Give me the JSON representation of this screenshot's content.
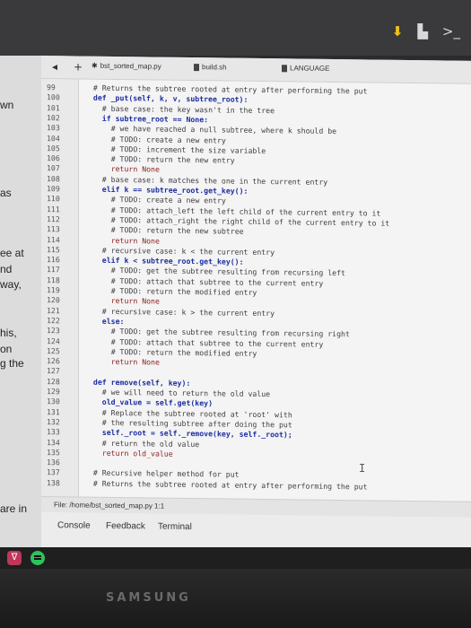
{
  "side_document": {
    "fragments": [
      "wn",
      "as",
      "ee at",
      "nd",
      "way,",
      "his,",
      "on",
      "g the",
      "are in"
    ]
  },
  "editor": {
    "tabs": [
      {
        "label": "bst_sorted_map.py"
      },
      {
        "label": "build.sh"
      },
      {
        "label": "LANGUAGE"
      }
    ],
    "lines": [
      {
        "n": "99",
        "indent": 2,
        "text": "# Returns the subtree rooted at entry after performing the put",
        "style": "cm"
      },
      {
        "n": "100",
        "indent": 2,
        "text": "def _put(self, k, v, subtree_root):",
        "style": "kw"
      },
      {
        "n": "101",
        "indent": 4,
        "text": "# base case: the key wasn't in the tree",
        "style": "cm"
      },
      {
        "n": "102",
        "indent": 4,
        "text": "if subtree_root == None:",
        "style": "kw"
      },
      {
        "n": "103",
        "indent": 6,
        "text": "# we have reached a null subtree, where k should be",
        "style": "cm"
      },
      {
        "n": "104",
        "indent": 6,
        "text": "# TODO: create a new entry",
        "style": "cm"
      },
      {
        "n": "105",
        "indent": 6,
        "text": "# TODO: increment the size variable",
        "style": "cm"
      },
      {
        "n": "106",
        "indent": 6,
        "text": "# TODO: return the new entry",
        "style": "cm"
      },
      {
        "n": "107",
        "indent": 6,
        "text": "return None",
        "style": "kwp"
      },
      {
        "n": "108",
        "indent": 4,
        "text": "# base case: k matches the one in the current entry",
        "style": "cm"
      },
      {
        "n": "109",
        "indent": 4,
        "text": "elif k == subtree_root.get_key():",
        "style": "kw"
      },
      {
        "n": "110",
        "indent": 6,
        "text": "# TODO: create a new entry",
        "style": "cm"
      },
      {
        "n": "111",
        "indent": 6,
        "text": "# TODO: attach_left the left child of the current entry to it",
        "style": "cm"
      },
      {
        "n": "112",
        "indent": 6,
        "text": "# TODO: attach_right the right child of the current entry to it",
        "style": "cm"
      },
      {
        "n": "113",
        "indent": 6,
        "text": "# TODO: return the new subtree",
        "style": "cm"
      },
      {
        "n": "114",
        "indent": 6,
        "text": "return None",
        "style": "kwp"
      },
      {
        "n": "115",
        "indent": 4,
        "text": "# recursive case: k < the current entry",
        "style": "cm"
      },
      {
        "n": "116",
        "indent": 4,
        "text": "elif k < subtree_root.get_key():",
        "style": "kw"
      },
      {
        "n": "117",
        "indent": 6,
        "text": "# TODO: get the subtree resulting from recursing left",
        "style": "cm"
      },
      {
        "n": "118",
        "indent": 6,
        "text": "# TODO: attach that subtree to the current entry",
        "style": "cm"
      },
      {
        "n": "119",
        "indent": 6,
        "text": "# TODO: return the modified entry",
        "style": "cm"
      },
      {
        "n": "120",
        "indent": 6,
        "text": "return None",
        "style": "kwp"
      },
      {
        "n": "121",
        "indent": 4,
        "text": "# recursive case: k > the current entry",
        "style": "cm"
      },
      {
        "n": "122",
        "indent": 4,
        "text": "else:",
        "style": "kw"
      },
      {
        "n": "123",
        "indent": 6,
        "text": "# TODO: get the subtree resulting from recursing right",
        "style": "cm"
      },
      {
        "n": "124",
        "indent": 6,
        "text": "# TODO: attach that subtree to the current entry",
        "style": "cm"
      },
      {
        "n": "125",
        "indent": 6,
        "text": "# TODO: return the modified entry",
        "style": "cm"
      },
      {
        "n": "126",
        "indent": 6,
        "text": "return None",
        "style": "kwp"
      },
      {
        "n": "127",
        "indent": 0,
        "text": "",
        "style": "cm"
      },
      {
        "n": "128",
        "indent": 2,
        "text": "def remove(self, key):",
        "style": "kw"
      },
      {
        "n": "129",
        "indent": 4,
        "text": "# we will need to return the old value",
        "style": "cm"
      },
      {
        "n": "130",
        "indent": 4,
        "text": "old_value = self.get(key)",
        "style": "kw"
      },
      {
        "n": "131",
        "indent": 4,
        "text": "# Replace the subtree rooted at 'root' with",
        "style": "cm"
      },
      {
        "n": "132",
        "indent": 4,
        "text": "# the resulting subtree after doing the put",
        "style": "cm"
      },
      {
        "n": "133",
        "indent": 4,
        "text": "self._root = self._remove(key, self._root);",
        "style": "kw"
      },
      {
        "n": "134",
        "indent": 4,
        "text": "# return the old value",
        "style": "cm"
      },
      {
        "n": "135",
        "indent": 4,
        "text": "return old_value",
        "style": "kwp"
      },
      {
        "n": "136",
        "indent": 0,
        "text": "",
        "style": "cm"
      },
      {
        "n": "137",
        "indent": 2,
        "text": "# Recursive helper method for put",
        "style": "cm"
      },
      {
        "n": "138",
        "indent": 2,
        "text": "# Returns the subtree rooted at entry after performing the put",
        "style": "cm"
      }
    ],
    "status": "File: /home/bst_sorted_map.py 1:1",
    "bottom_tabs": [
      "Console",
      "Feedback",
      "Terminal"
    ]
  },
  "monitor": {
    "brand": "SAMSUNG"
  },
  "colors": {
    "keyword": "#1c2ea0",
    "return": "#8a1e1e",
    "music_app": "#c0355a",
    "spotify": "#2bc35b"
  }
}
